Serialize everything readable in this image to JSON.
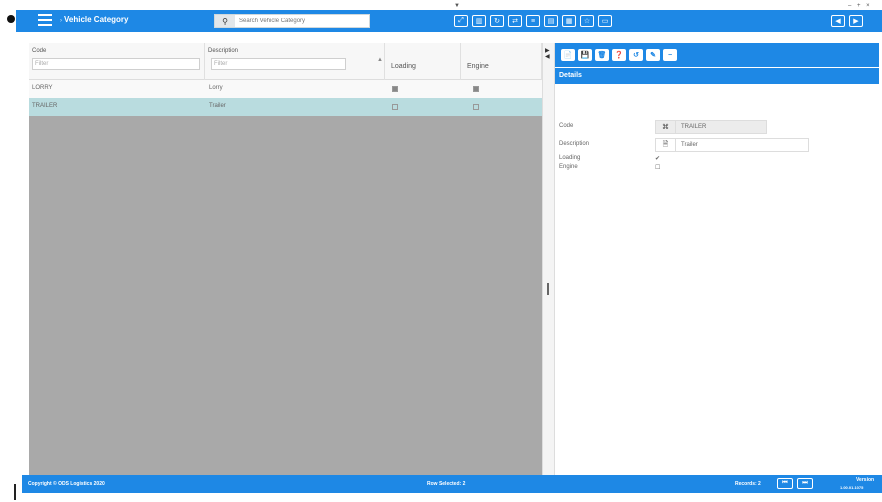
{
  "app": {
    "title_prefix": "›",
    "title": "Vehicle Category",
    "top_marker": "▼",
    "window_controls": "– + ×"
  },
  "search": {
    "placeholder": "Search Vehicle Category",
    "icon": "search-icon"
  },
  "toolbar": {
    "buttons": [
      {
        "icon": "expand-icon",
        "glyph": "⤢"
      },
      {
        "icon": "columns-icon",
        "glyph": "▥"
      },
      {
        "icon": "refresh-icon",
        "glyph": "↻"
      },
      {
        "icon": "share-icon",
        "glyph": "⇄"
      },
      {
        "icon": "list-icon",
        "glyph": "≡"
      },
      {
        "icon": "export-icon",
        "glyph": "▤"
      },
      {
        "icon": "print-icon",
        "glyph": "▦"
      },
      {
        "icon": "star-icon",
        "glyph": "☆"
      },
      {
        "icon": "window-icon",
        "glyph": "▭"
      }
    ],
    "right_buttons": [
      {
        "icon": "back-icon",
        "glyph": "◀"
      },
      {
        "icon": "forward-icon",
        "glyph": "▶"
      }
    ]
  },
  "grid": {
    "columns": [
      {
        "label": "Code",
        "filter": "Filter"
      },
      {
        "label": "Description",
        "filter": "Filter"
      },
      {
        "label": "Loading"
      },
      {
        "label": "Engine"
      }
    ],
    "sort_glyph": "▲",
    "rows": [
      {
        "code": "LORRY",
        "description": "Lorry",
        "loading": true,
        "engine": true
      },
      {
        "code": "TRAILER",
        "description": "Trailer",
        "loading": false,
        "engine": false
      }
    ]
  },
  "detail": {
    "toolbar_glyphs": [
      "📄",
      "💾",
      "🗑",
      "❓",
      "↺",
      "✎",
      "−"
    ],
    "heading": "Details",
    "fields": {
      "code_label": "Code",
      "code_value": "TRAILER",
      "code_icon": "⌘",
      "description_label": "Description",
      "description_value": "Trailer",
      "description_icon": "🗎",
      "loading_label": "Loading",
      "loading_value": "✔",
      "engine_label": "Engine",
      "engine_value": "☐"
    }
  },
  "footer": {
    "copyright": "Copyright © ODS Logistics 2020",
    "row_selected": "Row Selected: 2",
    "records": "Records: 2",
    "version_label": "Version",
    "version": "1.00.01.1075"
  },
  "colors": {
    "accent": "#1e88e5",
    "grid_bg": "#a9a9a9",
    "selected_row": "#b9dcdf"
  }
}
